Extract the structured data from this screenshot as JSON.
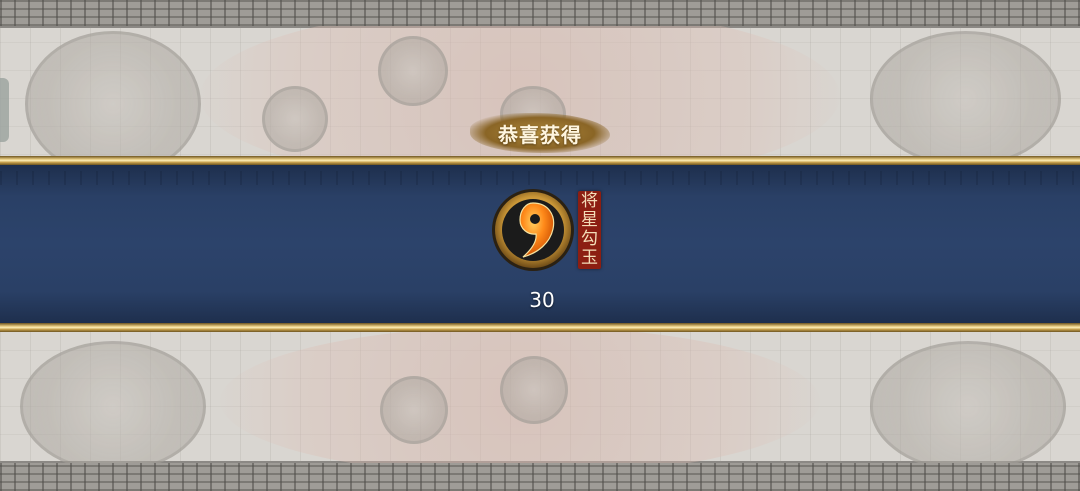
{
  "dialog": {
    "title": "恭喜获得"
  },
  "reward": {
    "name_chars": [
      "将",
      "星",
      "勾",
      "玉"
    ],
    "count": "30",
    "icon": "magatama-jade-icon"
  },
  "colors": {
    "band_navy": "#2c436b",
    "gold_trim": "#e2c57a",
    "title_banner": "#8a6526",
    "name_tag_red": "#8c1e12"
  }
}
